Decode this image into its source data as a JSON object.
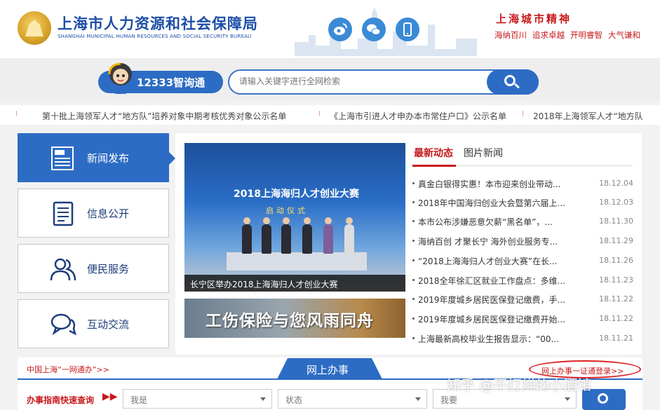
{
  "header": {
    "title_cn": "上海市人力资源和社会保障局",
    "title_en": "SHANGHAI MUNICIPAL HUMAN RESOURCES AND SOCIAL SECURITY BUREAU",
    "spirit_title": "上海城市精神",
    "spirit_words": [
      "海纳百川",
      "追求卓越",
      "开明睿智",
      "大气谦和"
    ],
    "social_icons": [
      "weibo-icon",
      "wechat-icon",
      "mobile-icon"
    ]
  },
  "search": {
    "hotline_label": "12333智询通",
    "placeholder": "请输入关键字进行全网检索"
  },
  "ticker": {
    "items": [
      "第十批上海领军人才“地方队”培养对象中期考核优秀对象公示名单",
      "《上海市引进人才申办本市常住户口》公示名单",
      "2018年上海领军人才“地方队"
    ]
  },
  "nav": {
    "items": [
      {
        "label": "新闻发布",
        "icon": "newspaper-icon"
      },
      {
        "label": "信息公开",
        "icon": "document-icon"
      },
      {
        "label": "便民服务",
        "icon": "users-icon"
      },
      {
        "label": "互动交流",
        "icon": "chat-icon"
      }
    ]
  },
  "feature": {
    "stage_title": "2018上海海归人才创业大赛",
    "stage_sub": "启动仪式",
    "caption": "长宁区举办2018上海海归人才创业大赛",
    "banner2": "工伤保险与您风雨同舟"
  },
  "news": {
    "tab_latest": "最新动态",
    "tab_photo": "图片新闻",
    "items": [
      {
        "title": "真金白银得实惠！本市迎来创业带动...",
        "date": "18.12.04"
      },
      {
        "title": "2018年中国海归创业大会暨第六届上...",
        "date": "18.12.03"
      },
      {
        "title": "本市公布涉嫌恶意欠薪“黑名单”，...",
        "date": "18.11.30"
      },
      {
        "title": "海纳百创 才聚长宁 海外创业服务专...",
        "date": "18.11.29"
      },
      {
        "title": "“2018上海海归人才创业大赛”在长...",
        "date": "18.11.26"
      },
      {
        "title": "2018全年徐汇区就业工作盘点：多维...",
        "date": "18.11.23"
      },
      {
        "title": "2019年度城乡居民医保登记缴费，手...",
        "date": "18.11.22"
      },
      {
        "title": "2019年度城乡居民医保登记缴费开始...",
        "date": "18.11.22"
      },
      {
        "title": "上海最新高校毕业生报告显示：“00...",
        "date": "18.11.21"
      }
    ]
  },
  "bottom": {
    "yiwang_link": "中国上海“一网通办”>>",
    "online_tab": "网上办事",
    "oneid_link": "网上办事一证通登录>>",
    "guide_label": "办事指南快速查询",
    "selects": [
      "我是",
      "状态",
      "我要"
    ]
  },
  "watermark": "知乎 @不打烊的小酒馆",
  "colors": {
    "brand_blue": "#2d6cc4",
    "accent_red": "#c8191b"
  }
}
